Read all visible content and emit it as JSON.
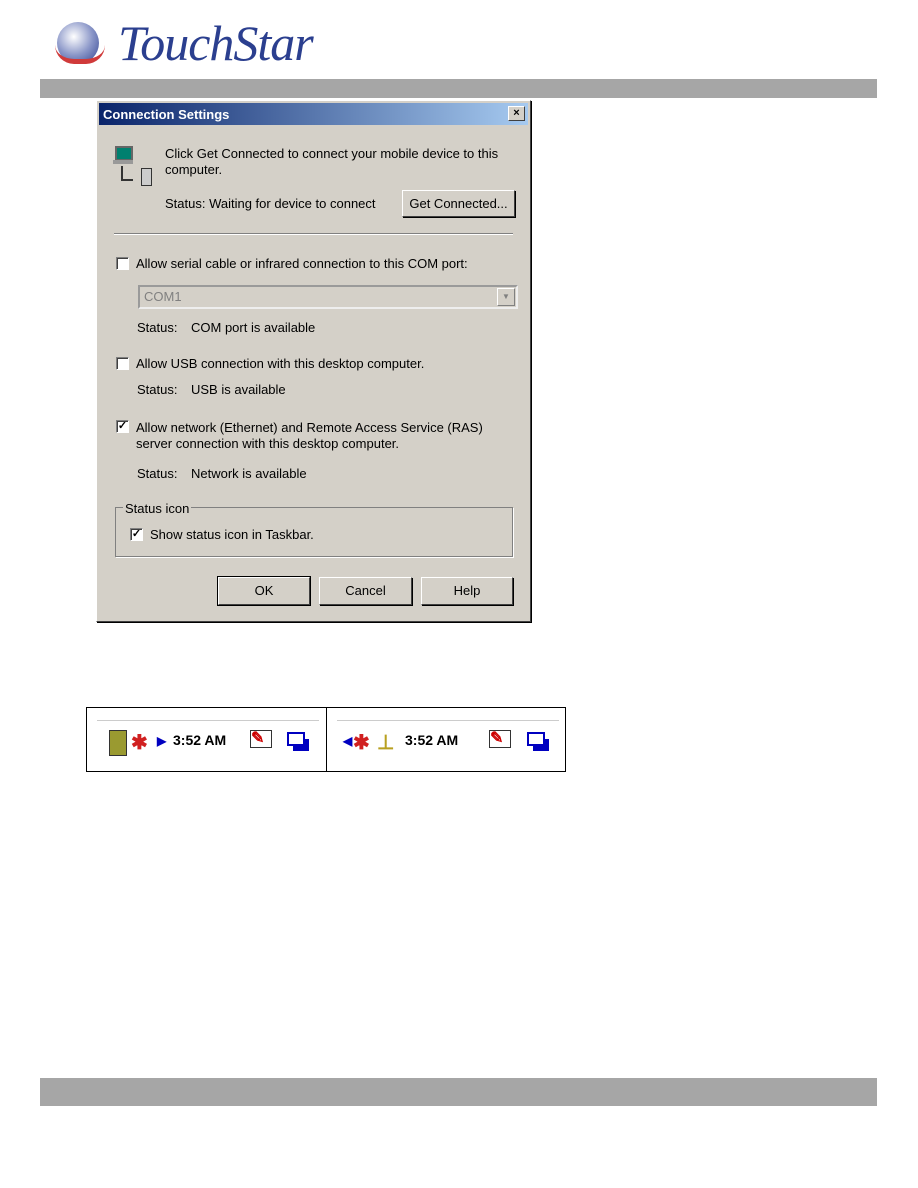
{
  "header": {
    "logo_text": "TouchStar"
  },
  "dialog": {
    "title": "Connection Settings",
    "close": "×",
    "intro": "Click Get Connected to connect your mobile device to this",
    "intro2": "computer.",
    "status": "Status: Waiting for device to connect",
    "get_connected": "Get Connected...",
    "serial": {
      "label": "Allow serial cable or infrared connection to this COM port:",
      "checked": false,
      "port": "COM1",
      "status_label": "Status:",
      "status": "COM port is available"
    },
    "usb": {
      "label": "Allow USB connection with this desktop computer.",
      "checked": false,
      "status_label": "Status:",
      "status": "USB is available"
    },
    "network": {
      "label": "Allow network (Ethernet) and Remote Access Service (RAS)",
      "label2": "server connection with this desktop computer.",
      "checked": true,
      "status_label": "Status:",
      "status": "Network is available"
    },
    "group": {
      "legend": "Status icon",
      "label": "Show status icon in Taskbar.",
      "checked": true
    },
    "ok": "OK",
    "cancel": "Cancel",
    "help": "Help"
  },
  "taskbars": [
    {
      "time": "3:52 AM"
    },
    {
      "time": "3:52 AM"
    }
  ]
}
